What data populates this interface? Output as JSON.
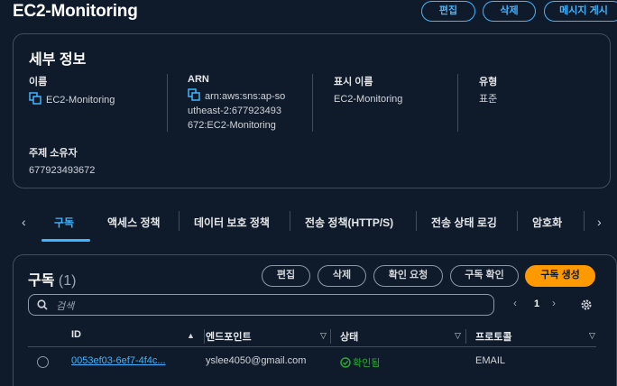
{
  "header": {
    "title": "EC2-Monitoring",
    "buttons": {
      "edit": "편집",
      "delete": "삭제",
      "publish": "메시지 게시"
    }
  },
  "details": {
    "title": "세부 정보",
    "name": {
      "label": "이름",
      "value": "EC2-Monitoring"
    },
    "arn": {
      "label": "ARN",
      "line1": "arn:aws:sns:ap-so",
      "line2": "utheast-2:677923493",
      "line3": "672:EC2-Monitoring"
    },
    "display_name": {
      "label": "표시 이름",
      "value": "EC2-Monitoring"
    },
    "type": {
      "label": "유형",
      "value": "표준"
    },
    "owner": {
      "label": "주제 소유자",
      "value": "677923493672"
    }
  },
  "tabs": [
    {
      "label": "구독"
    },
    {
      "label": "액세스 정책"
    },
    {
      "label": "데이터 보호 정책"
    },
    {
      "label": "전송 정책(HTTP/S)"
    },
    {
      "label": "전송 상태 로깅"
    },
    {
      "label": "암호화"
    }
  ],
  "subscriptions": {
    "title": "구독",
    "count": "(1)",
    "buttons": {
      "edit": "편집",
      "delete": "삭제",
      "request_confirm": "확인 요청",
      "confirm": "구독 확인",
      "create": "구독 생성"
    },
    "search_placeholder": "검색",
    "page": "1",
    "columns": [
      "ID",
      "엔드포인트",
      "상태",
      "프로토콜"
    ],
    "rows": [
      {
        "id": "0053ef03-6ef7-4f4c...",
        "endpoint": "yslee4050@gmail.com",
        "status": "확인됨",
        "protocol": "EMAIL"
      }
    ]
  },
  "colors": {
    "accent": "#42b4ff",
    "primary": "#ff9900",
    "success": "#29ad32",
    "background": "#0f1b2a"
  },
  "icons": [
    "copy-icon",
    "search-icon",
    "chevron-left-icon",
    "chevron-right-icon",
    "settings-icon",
    "sort-up-icon",
    "sort-down-icon",
    "check-circle-icon"
  ]
}
